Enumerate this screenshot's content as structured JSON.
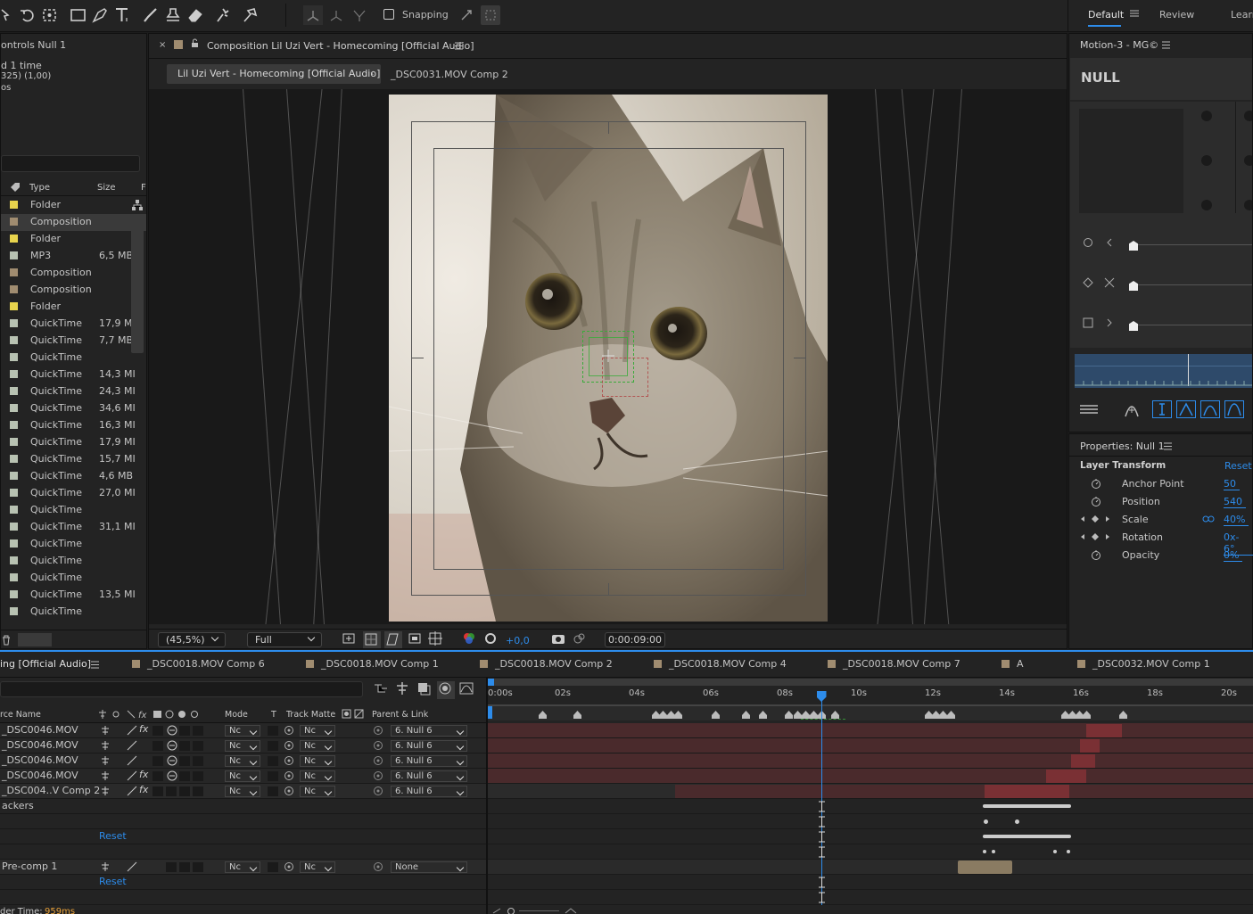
{
  "toolbar": {
    "snapping_label": "Snapping",
    "workspaces": [
      "Default",
      "Review",
      "Learn"
    ]
  },
  "project": {
    "header_name": "ontrols Null 1",
    "info_lines": [
      "d 1 time",
      "325) (1,00)",
      "os"
    ],
    "columns": {
      "type": "Type",
      "size": "Size",
      "f": "F"
    },
    "items": [
      {
        "type": "Folder",
        "size": "",
        "color": "#e8d44d"
      },
      {
        "type": "Composition",
        "size": "",
        "color": "#a08c70"
      },
      {
        "type": "Folder",
        "size": "",
        "color": "#e8d44d"
      },
      {
        "type": "MP3",
        "size": "6,5 MB",
        "color": "#b8c2b2"
      },
      {
        "type": "Composition",
        "size": "",
        "color": "#a08c70"
      },
      {
        "type": "Composition",
        "size": "",
        "color": "#a08c70"
      },
      {
        "type": "Folder",
        "size": "",
        "color": "#e8d44d"
      },
      {
        "type": "QuickTime",
        "size": "17,9 MI",
        "color": "#b8c2b2"
      },
      {
        "type": "QuickTime",
        "size": "7,7 MB",
        "color": "#b8c2b2"
      },
      {
        "type": "QuickTime",
        "size": "",
        "color": "#b8c2b2"
      },
      {
        "type": "QuickTime",
        "size": "14,3 MI",
        "color": "#b8c2b2"
      },
      {
        "type": "QuickTime",
        "size": "24,3 MI",
        "color": "#b8c2b2"
      },
      {
        "type": "QuickTime",
        "size": "34,6 MI",
        "color": "#b8c2b2"
      },
      {
        "type": "QuickTime",
        "size": "16,3 MI",
        "color": "#b8c2b2"
      },
      {
        "type": "QuickTime",
        "size": "17,9 MI",
        "color": "#b8c2b2"
      },
      {
        "type": "QuickTime",
        "size": "15,7 MI",
        "color": "#b8c2b2"
      },
      {
        "type": "QuickTime",
        "size": "4,6 MB",
        "color": "#b8c2b2"
      },
      {
        "type": "QuickTime",
        "size": "27,0 MI",
        "color": "#b8c2b2"
      },
      {
        "type": "QuickTime",
        "size": "",
        "color": "#b8c2b2"
      },
      {
        "type": "QuickTime",
        "size": "31,1 MI",
        "color": "#b8c2b2"
      },
      {
        "type": "QuickTime",
        "size": "",
        "color": "#b8c2b2"
      },
      {
        "type": "QuickTime",
        "size": "",
        "color": "#b8c2b2"
      },
      {
        "type": "QuickTime",
        "size": "",
        "color": "#b8c2b2"
      },
      {
        "type": "QuickTime",
        "size": "13,5 MI",
        "color": "#b8c2b2"
      },
      {
        "type": "QuickTime",
        "size": "",
        "color": "#b8c2b2"
      }
    ]
  },
  "composition": {
    "panel_title": "Composition Lil Uzi Vert - Homecoming [Official Audio]",
    "tab_active": "Lil Uzi Vert - Homecoming [Official Audio]",
    "tab_other": "_DSC0031.MOV Comp 2",
    "zoom": "(45,5%)",
    "resolution": "Full",
    "exposure": "+0,0",
    "timecode": "0:00:09:00"
  },
  "motion": {
    "title": "Motion-3 - MG©",
    "null_label": "NULL"
  },
  "properties": {
    "title": "Properties: Null 1",
    "section": "Layer Transform",
    "reset": "Reset",
    "rows": [
      {
        "label": "Anchor Point",
        "value": "50"
      },
      {
        "label": "Position",
        "value": "540"
      },
      {
        "label": "Scale",
        "value": "40%"
      },
      {
        "label": "Rotation",
        "value": "0x-6°"
      },
      {
        "label": "Opacity",
        "value": "0%"
      }
    ]
  },
  "timeline": {
    "tabs": [
      "ing [Official Audio]",
      "_DSC0018.MOV Comp 6",
      "_DSC0018.MOV Comp 1",
      "_DSC0018.MOV Comp 2",
      "_DSC0018.MOV Comp 4",
      "_DSC0018.MOV Comp 7",
      "A",
      "_DSC0032.MOV Comp 1"
    ],
    "col_headers": {
      "source": "rce Name",
      "mode": "Mode",
      "t": "T",
      "track_matte": "Track Matte",
      "parent": "Parent & Link"
    },
    "layers": [
      {
        "name": "_DSC0046.MOV",
        "fx": true,
        "mode": "Nc",
        "matte": "Nc",
        "parent": "6. Null 6"
      },
      {
        "name": "_DSC0046.MOV",
        "fx": false,
        "mode": "Nc",
        "matte": "Nc",
        "parent": "6. Null 6"
      },
      {
        "name": "_DSC0046.MOV",
        "fx": false,
        "mode": "Nc",
        "matte": "Nc",
        "parent": "6. Null 6"
      },
      {
        "name": "_DSC0046.MOV",
        "fx": true,
        "mode": "Nc",
        "matte": "Nc",
        "parent": "6. Null 6"
      },
      {
        "name": "_DSC004..V Comp 2",
        "fx": true,
        "mode": "Nc",
        "matte": "Nc",
        "parent": "6. Null 6"
      }
    ],
    "trackers_label": "ackers",
    "reset_label": "Reset",
    "precomp": {
      "name": "Pre-comp 1",
      "mode": "Nc",
      "matte": "Nc",
      "parent": "None"
    },
    "render_time_label": "der Time:",
    "render_time_value": "959ms",
    "ruler": [
      "0:00s",
      "02s",
      "04s",
      "06s",
      "08s",
      "10s",
      "12s",
      "14s",
      "16s",
      "18s",
      "20s"
    ],
    "playhead_seconds": 9
  }
}
